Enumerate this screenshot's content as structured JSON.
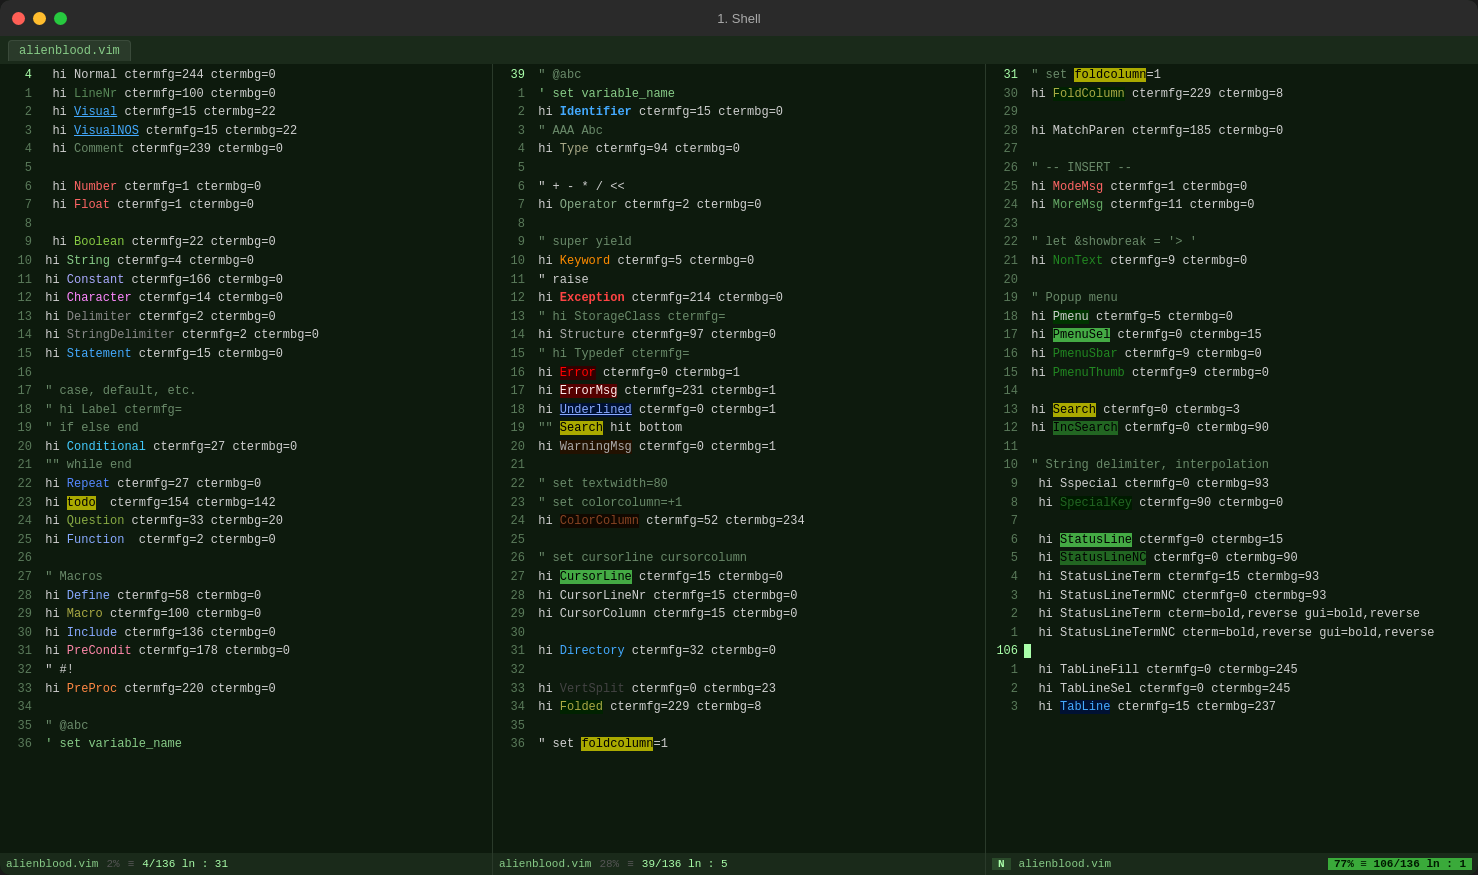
{
  "window": {
    "title": "1. Shell",
    "tab": "alienblood.vim"
  },
  "panes": [
    {
      "id": "pane1",
      "statusbar": {
        "mode": "",
        "filename": "alienblood.vim",
        "percent": "2%",
        "position": "4/136 ln : 31"
      }
    },
    {
      "id": "pane2",
      "statusbar": {
        "mode": "",
        "filename": "alienblood.vim",
        "percent": "28%",
        "position": "39/136 ln : 5"
      }
    },
    {
      "id": "pane3",
      "statusbar": {
        "mode": "N",
        "filename": "alienblood.vim",
        "percent": "77%",
        "position": "106/136 ln : 1"
      }
    }
  ]
}
